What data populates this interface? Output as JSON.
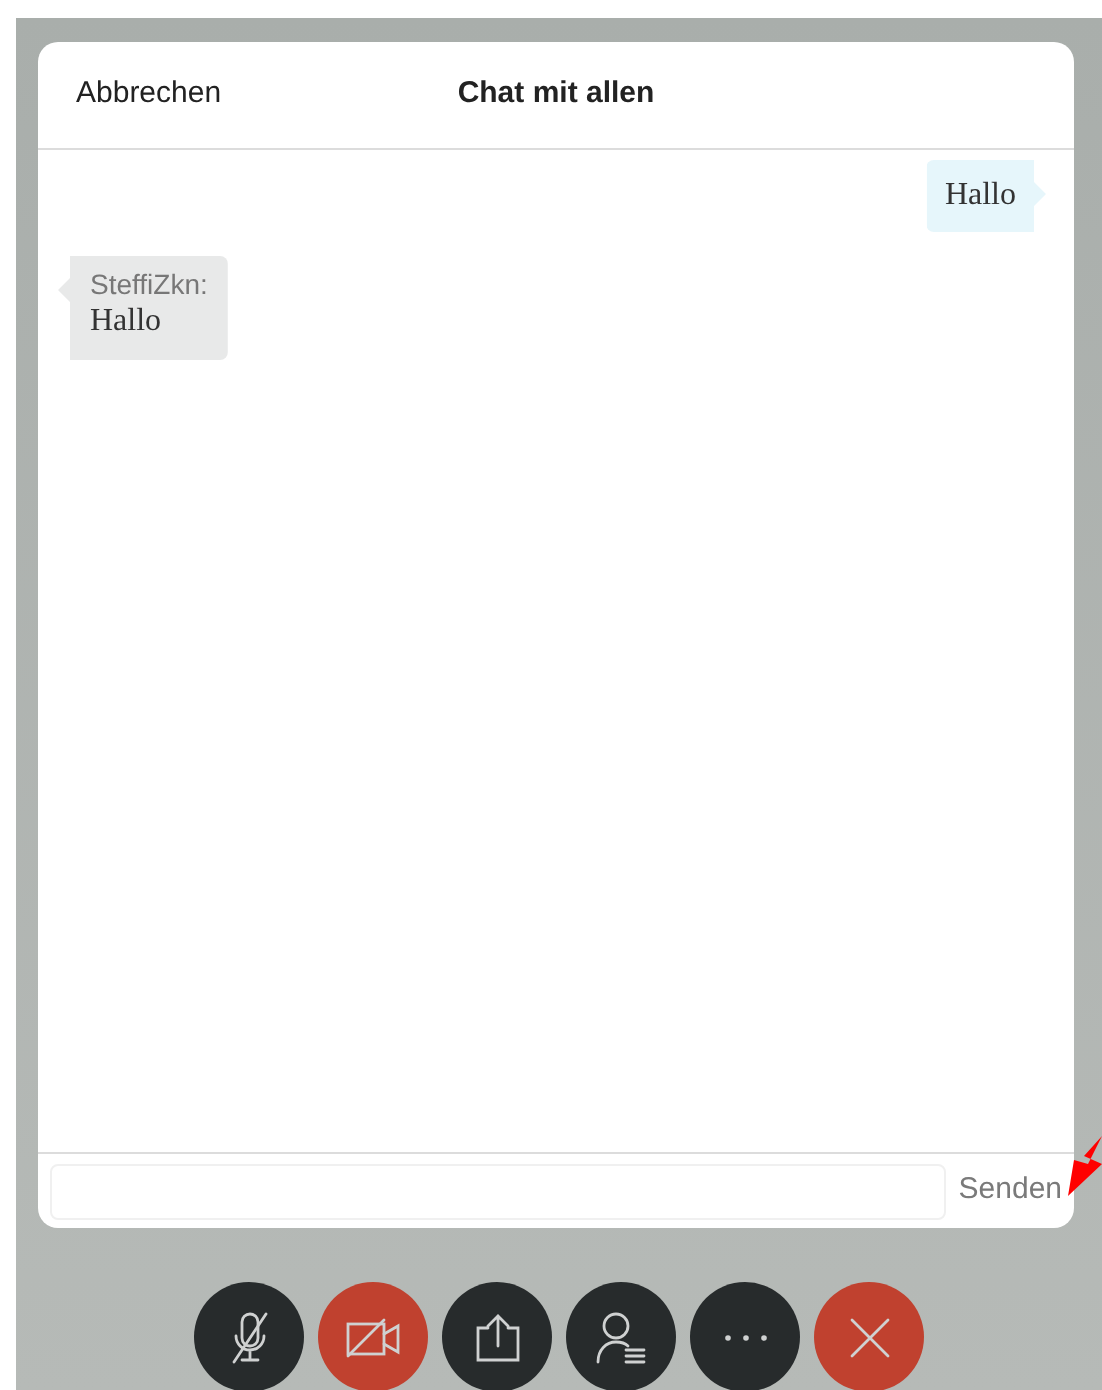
{
  "dialog": {
    "cancel": "Abbrechen",
    "title": "Chat mit allen"
  },
  "messages": [
    {
      "kind": "outgoing",
      "text": "Hallo"
    },
    {
      "kind": "incoming",
      "sender": "SteffiZkn:",
      "text": "Hallo"
    }
  ],
  "composer": {
    "send": "Senden"
  },
  "controls": [
    {
      "kind": "mic-off",
      "color": "#272b2c"
    },
    {
      "kind": "camera-off",
      "color": "#c0412f"
    },
    {
      "kind": "share",
      "color": "#272b2c"
    },
    {
      "kind": "participants",
      "color": "#272b2c"
    },
    {
      "kind": "more",
      "color": "#272b2c"
    },
    {
      "kind": "leave",
      "color": "#c0412f"
    }
  ]
}
